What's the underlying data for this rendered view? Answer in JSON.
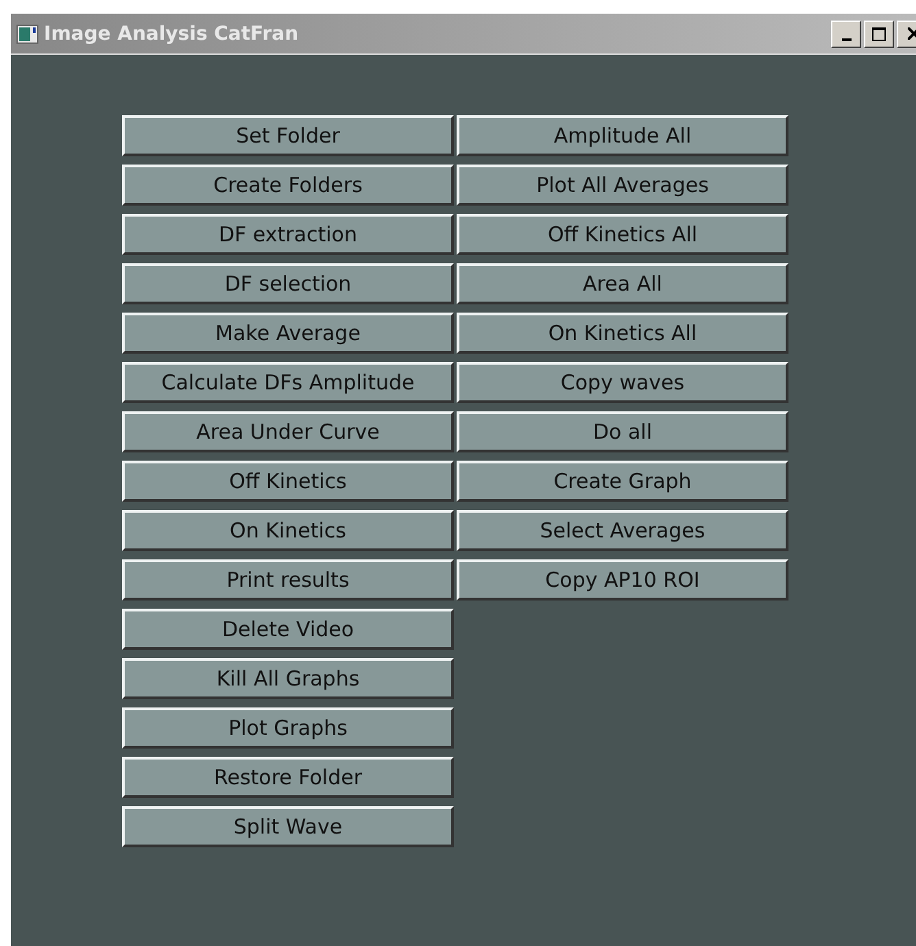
{
  "window": {
    "title": "Image Analysis CatFran"
  },
  "columns": [
    [
      "Set Folder",
      "Create Folders",
      "DF extraction",
      "DF selection",
      "Make Average",
      "Calculate DFs Amplitude",
      "Area Under Curve",
      "Off Kinetics",
      "On Kinetics",
      "Print results",
      "Delete Video",
      "Kill All Graphs",
      "Plot Graphs",
      "Restore Folder",
      "Split Wave"
    ],
    [
      "Amplitude All",
      "Plot All Averages",
      "Off Kinetics All",
      "Area All",
      "On Kinetics All",
      "Copy waves",
      "Do all",
      "Create Graph",
      "Select Averages",
      "Copy AP10 ROI"
    ]
  ]
}
